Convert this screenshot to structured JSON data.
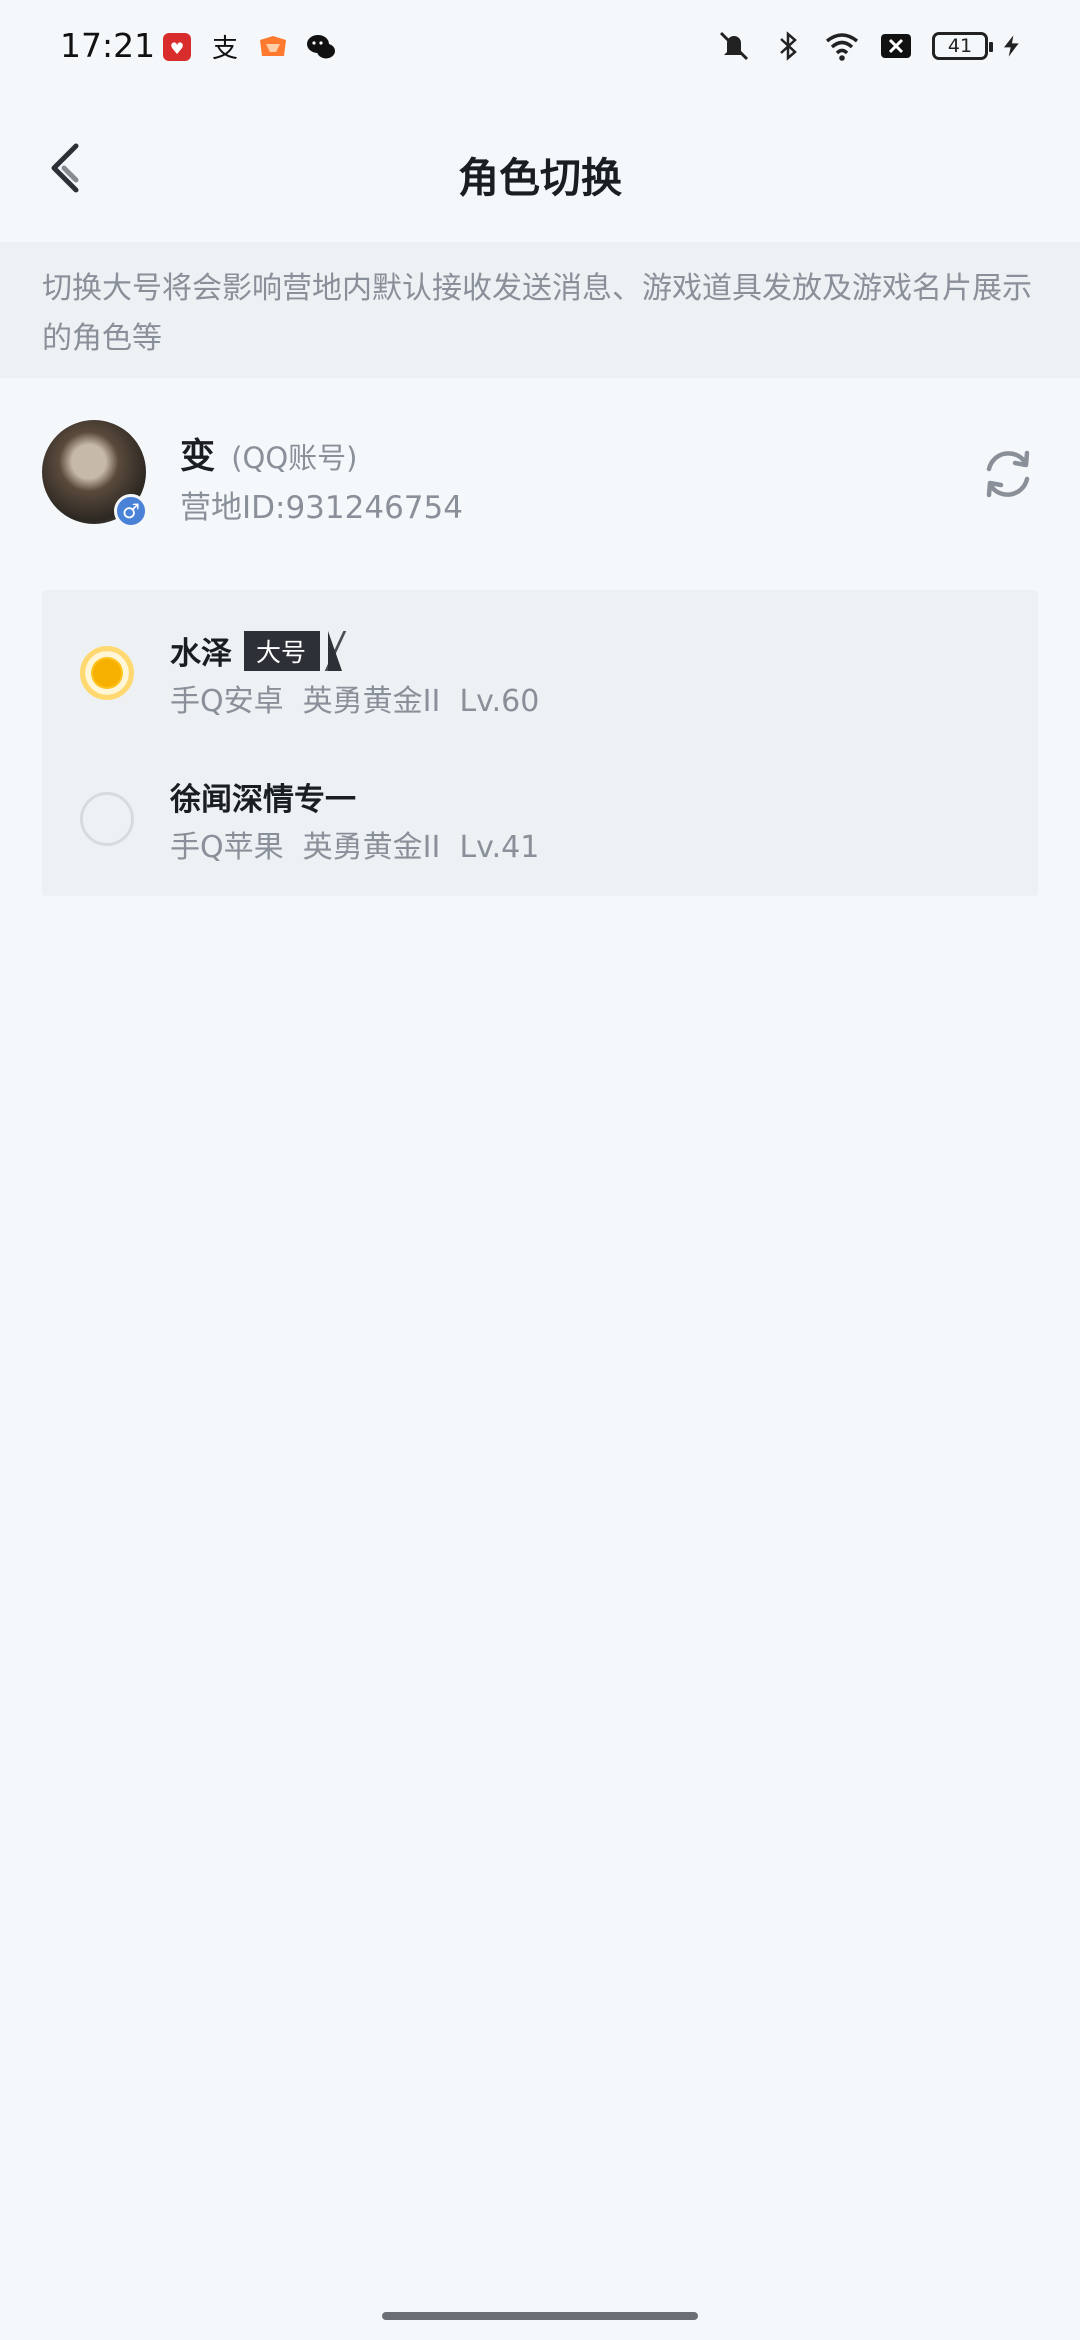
{
  "status_bar": {
    "time": "17:21",
    "notification_icons": [
      "app-red-icon",
      "alipay-icon",
      "app-orange-icon",
      "wechat-icon"
    ],
    "system_icons": [
      "mute-icon",
      "bluetooth-icon",
      "wifi-icon",
      "close-box-icon"
    ],
    "battery": "41"
  },
  "nav": {
    "title": "角色切换"
  },
  "notice": {
    "text": "切换大号将会影响营地内默认接收发送消息、游戏道具发放及游戏名片展示的角色等"
  },
  "profile": {
    "name": "变",
    "account_type": "(QQ账号)",
    "camp_id": "营地ID:931246754",
    "gender_badge": "♂"
  },
  "roles": [
    {
      "name": "水泽",
      "badge": "大号",
      "detail": "手Q安卓  英勇黄金II  Lv.60",
      "selected": true
    },
    {
      "name": "徐闻深情专一",
      "detail": "手Q苹果  英勇黄金II  Lv.41",
      "selected": false
    }
  ],
  "colors": {
    "background": "#f5f8fb",
    "notice_bg": "#eef1f4",
    "selected_radio": "#ffc21c",
    "badge_bg": "#2d3137"
  }
}
